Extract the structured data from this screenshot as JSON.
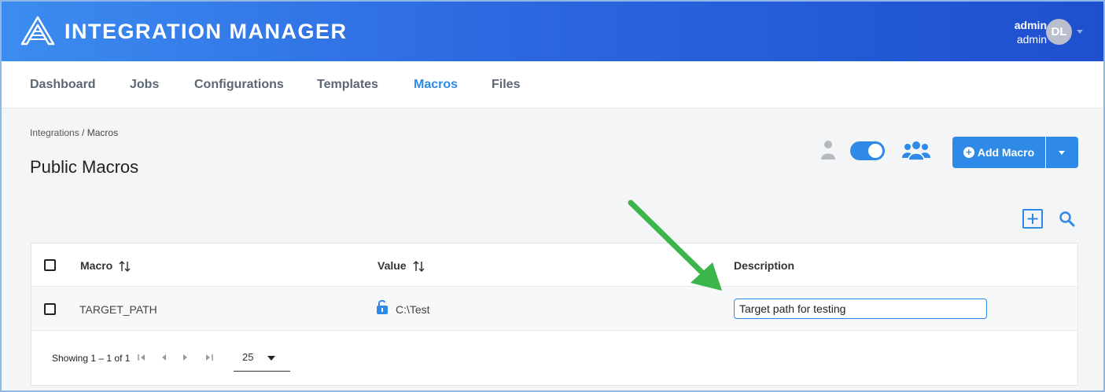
{
  "header": {
    "title": "INTEGRATION MANAGER",
    "user_name": "admin",
    "user_role": "admin",
    "avatar_initials": "DL"
  },
  "nav": {
    "tabs": [
      {
        "label": "Dashboard",
        "active": false
      },
      {
        "label": "Jobs",
        "active": false
      },
      {
        "label": "Configurations",
        "active": false
      },
      {
        "label": "Templates",
        "active": false
      },
      {
        "label": "Macros",
        "active": true
      },
      {
        "label": "Files",
        "active": false
      }
    ]
  },
  "breadcrumb": {
    "root": "Integrations",
    "separator": " / ",
    "current": "Macros"
  },
  "page": {
    "title": "Public Macros",
    "add_button_label": "Add Macro",
    "public_toggle_on": true
  },
  "table": {
    "columns": [
      "Macro",
      "Value",
      "Description"
    ],
    "rows": [
      {
        "macro": "TARGET_PATH",
        "value": "C:\\Test",
        "value_icon": "lock-open-icon",
        "description": "Target path for testing"
      }
    ],
    "footer": {
      "showing": "Showing 1 – 1 of 1",
      "page_size": "25"
    }
  },
  "colors": {
    "accent": "#2e8ae6",
    "header_start": "#3c8cf0",
    "header_end": "#1e4fcf",
    "annotation_arrow": "#3cb54a"
  }
}
